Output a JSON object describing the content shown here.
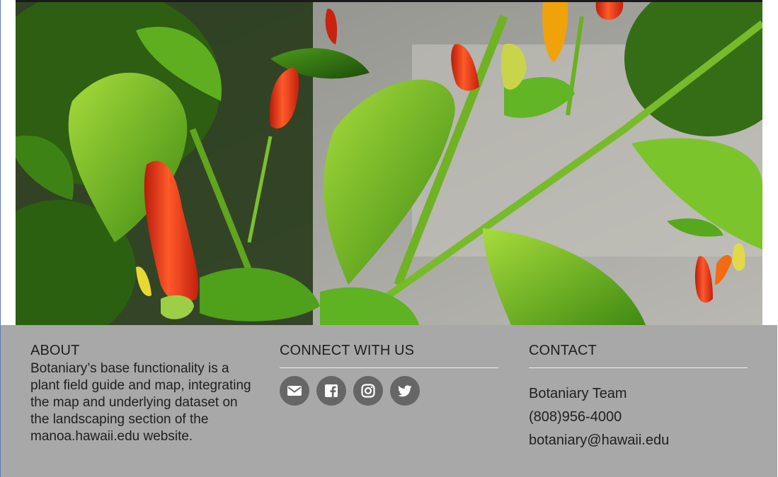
{
  "hero": {
    "image": "red-chili-pepper-plant-photo"
  },
  "footer": {
    "about": {
      "heading": "ABOUT",
      "text": "Botaniary’s base functionality is a plant field guide and map, integrating the map and underlying dataset on the landscaping section of the manoa.hawaii.edu website."
    },
    "connect": {
      "heading": "CONNECT WITH US",
      "icons": [
        "envelope-icon",
        "facebook-icon",
        "instagram-icon",
        "twitter-icon"
      ]
    },
    "contact": {
      "heading": "CONTACT",
      "name": "Botaniary Team",
      "phone": "(808)956-4000",
      "email": "botaniary@hawaii.edu"
    }
  },
  "colors": {
    "footer_bg": "#a8a8a8",
    "social_btn_bg": "#666666",
    "text": "#1f1f1f",
    "pepper_red": "#e8341c"
  }
}
